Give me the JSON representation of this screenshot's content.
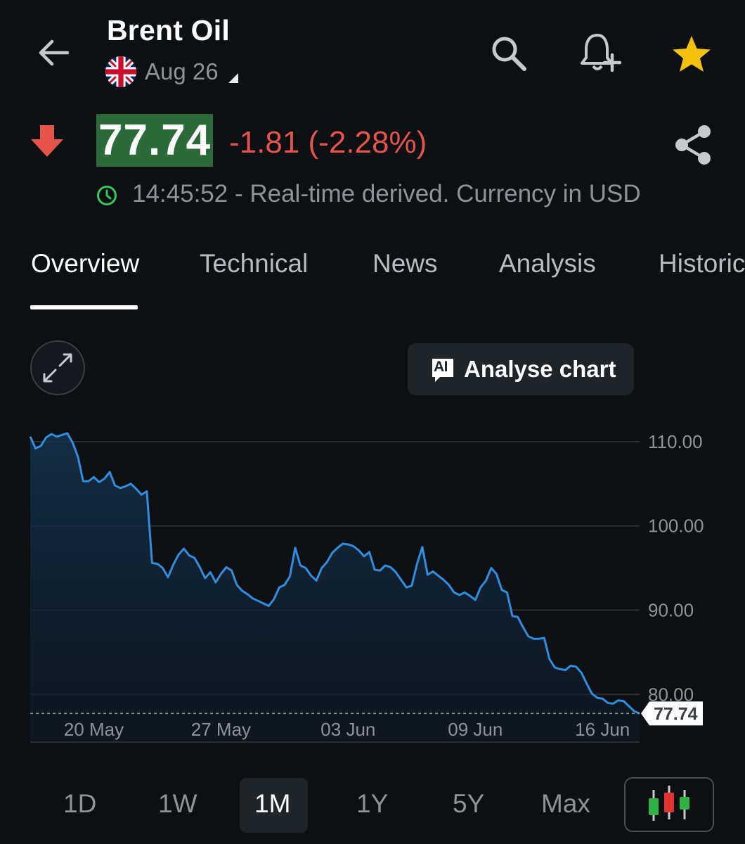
{
  "header": {
    "title": "Brent Oil",
    "contract_date": "Aug 26"
  },
  "quote": {
    "price": "77.74",
    "change": "-1.81 (-2.28%)",
    "direction": "down",
    "timestamp_text": "14:45:52 - Real-time derived. Currency in USD"
  },
  "tabs": [
    "Overview",
    "Technical",
    "News",
    "Analysis",
    "Historic"
  ],
  "active_tab": "Overview",
  "chart_controls": {
    "analyse_label": "Analyse chart",
    "ai_badge": "AI"
  },
  "ranges": [
    "1D",
    "1W",
    "1M",
    "1Y",
    "5Y",
    "Max"
  ],
  "active_range": "1M",
  "colors": {
    "background": "#0d1013",
    "price_highlight": "#2d6a3a",
    "down": "#e5534b",
    "line": "#2f8ee0",
    "star": "#f4c20d",
    "clock": "#34c759"
  },
  "chart_data": {
    "type": "area",
    "y_ticks": [
      110,
      100,
      90,
      80
    ],
    "y_tick_labels": [
      "110.00",
      "100.00",
      "90.00",
      "80.00"
    ],
    "x_tick_labels": [
      "20 May",
      "27 May",
      "03 Jun",
      "09 Jun",
      "16 Jun"
    ],
    "x_tick_indices": [
      12,
      36,
      60,
      84,
      108
    ],
    "ylim": [
      75.6,
      111.5
    ],
    "last_value": 77.74,
    "last_value_label": "77.74",
    "values": [
      110.6,
      109.2,
      109.5,
      110.5,
      110.9,
      110.6,
      110.8,
      111.0,
      109.9,
      108.2,
      105.3,
      105.3,
      105.8,
      105.2,
      105.6,
      106.4,
      104.8,
      104.5,
      104.7,
      105.0,
      104.4,
      103.7,
      104.1,
      95.6,
      95.5,
      95.0,
      93.9,
      95.4,
      96.6,
      97.3,
      96.5,
      96.2,
      95.1,
      93.8,
      94.5,
      93.3,
      94.3,
      95.1,
      94.7,
      93.0,
      92.3,
      91.9,
      91.4,
      91.1,
      90.8,
      90.5,
      91.3,
      92.7,
      93.0,
      94.0,
      97.4,
      95.3,
      95.0,
      94.1,
      93.5,
      95.0,
      95.7,
      96.8,
      97.4,
      97.9,
      97.8,
      97.6,
      97.1,
      96.4,
      96.9,
      94.8,
      94.7,
      95.3,
      95.1,
      94.5,
      93.6,
      92.7,
      92.9,
      95.5,
      97.5,
      94.2,
      94.6,
      94.1,
      93.6,
      93.0,
      92.1,
      91.8,
      92.1,
      91.7,
      91.2,
      92.7,
      93.5,
      95.0,
      94.3,
      92.4,
      92.1,
      89.3,
      89.2,
      88.0,
      86.9,
      86.6,
      86.6,
      86.7,
      84.2,
      83.2,
      83.0,
      82.9,
      83.4,
      83.3,
      82.6,
      81.3,
      80.1,
      79.6,
      79.5,
      79.0,
      78.9,
      79.3,
      79.2,
      78.6,
      78.0,
      77.74
    ]
  }
}
